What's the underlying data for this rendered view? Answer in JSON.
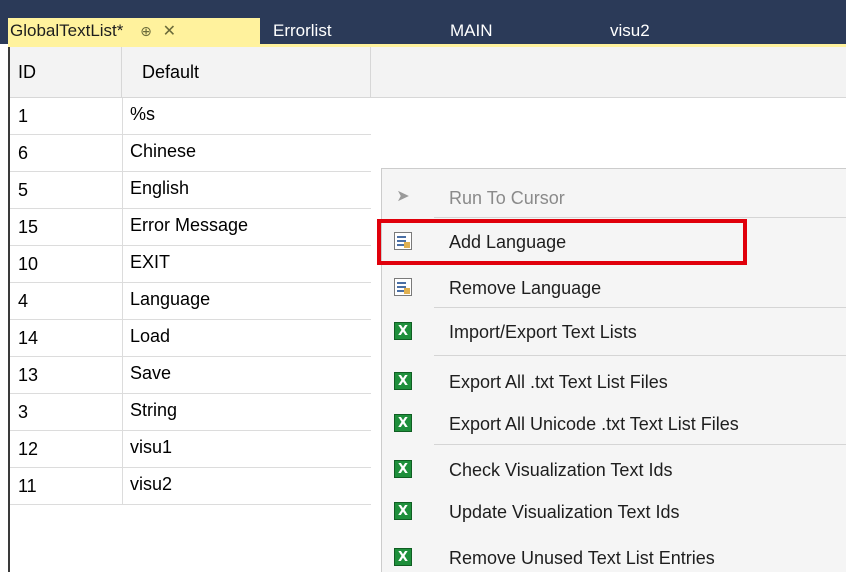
{
  "tabs": [
    {
      "label": "GlobalTextList*",
      "pin": "⊕",
      "close": "✕"
    },
    {
      "label": "Errorlist"
    },
    {
      "label": "MAIN"
    },
    {
      "label": "visu2"
    }
  ],
  "grid": {
    "headers": {
      "id": "ID",
      "default": "Default"
    },
    "rows": [
      {
        "id": "1",
        "default": "%s"
      },
      {
        "id": "6",
        "default": "Chinese"
      },
      {
        "id": "5",
        "default": "English"
      },
      {
        "id": "15",
        "default": "Error Message"
      },
      {
        "id": "10",
        "default": "EXIT"
      },
      {
        "id": "4",
        "default": "Language"
      },
      {
        "id": "14",
        "default": "Load"
      },
      {
        "id": "13",
        "default": "Save"
      },
      {
        "id": "3",
        "default": "String"
      },
      {
        "id": "12",
        "default": "visu1"
      },
      {
        "id": "11",
        "default": "visu2"
      }
    ]
  },
  "context_menu": {
    "items": [
      {
        "label": "Run To Cursor",
        "icon": "cursor-icon",
        "disabled": true
      },
      {
        "label": "Add Language",
        "icon": "add-language-icon",
        "highlighted": true
      },
      {
        "label": "Remove Language",
        "icon": "remove-language-icon"
      },
      {
        "label": "Import/Export Text Lists",
        "icon": "excel-icon"
      },
      {
        "label": "Export All .txt Text List Files",
        "icon": "excel-icon"
      },
      {
        "label": "Export All Unicode .txt Text List Files",
        "icon": "excel-icon"
      },
      {
        "label": "Check Visualization Text Ids",
        "icon": "excel-icon"
      },
      {
        "label": "Update Visualization Text Ids",
        "icon": "excel-icon"
      },
      {
        "label": "Remove Unused Text List Entries",
        "icon": "excel-icon"
      }
    ]
  },
  "colors": {
    "tabstrip": "#2b3a58",
    "active_tab": "#fff29d",
    "highlight_box": "#e0000b"
  }
}
